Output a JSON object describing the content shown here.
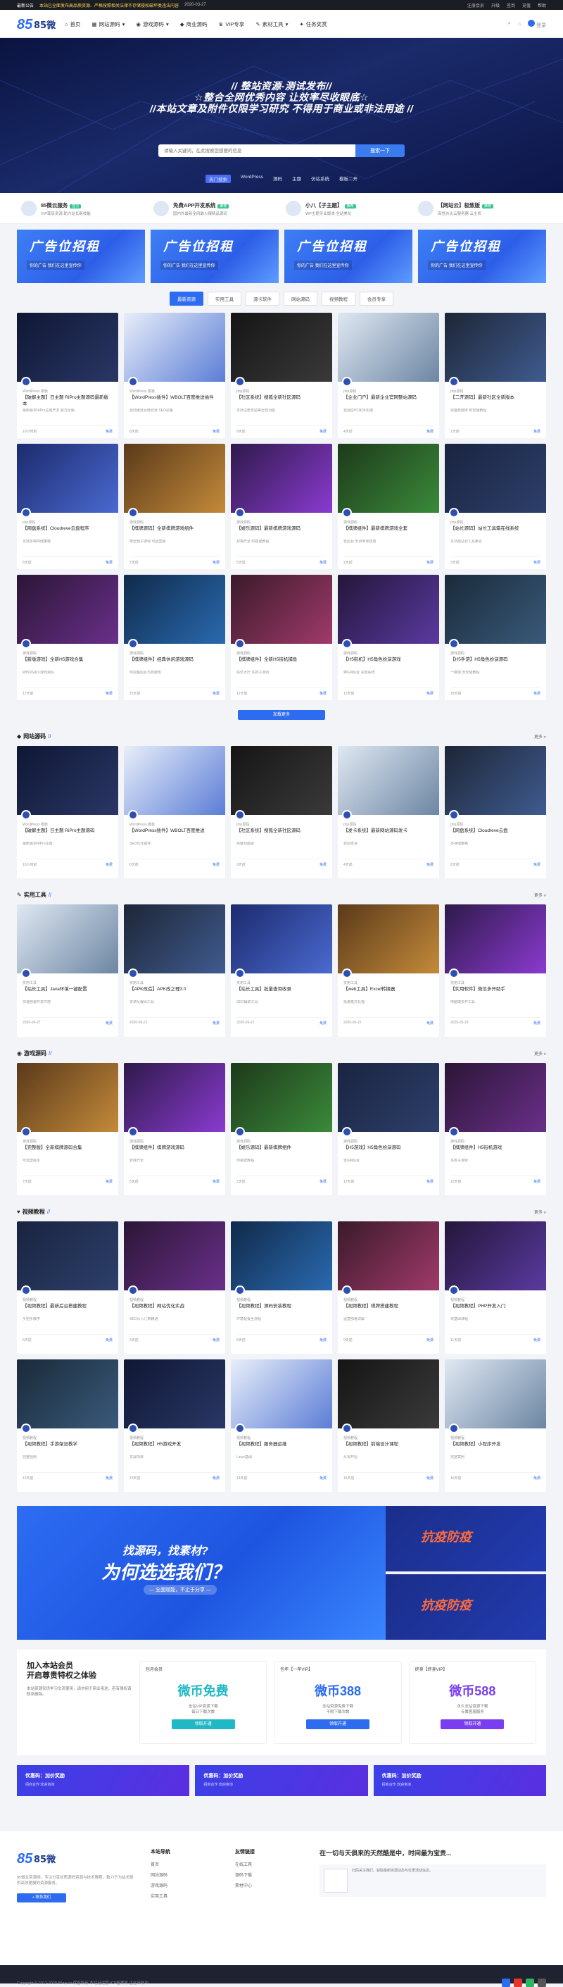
{
  "topbar": {
    "notice_label": "最新公告",
    "notice": "本站已全面发布高品质资源、严格按照相关法律不存储侵权破坏类违法内容",
    "date": "2020-03-27",
    "links": [
      "注册会员",
      "升级",
      "签到",
      "充值",
      "帮助"
    ]
  },
  "nav": {
    "logo": "85微云",
    "items": [
      "首页",
      "网站源码",
      "游戏源码",
      "商业源码",
      "VIP专享",
      "素材工具",
      "任务奖赏"
    ],
    "user": "登录"
  },
  "hero": {
    "line1": "// 整站资源-测试发布//",
    "line2": "☆整合全网优秀内容 让效率尽收眼底☆",
    "line3": "//本站文章及附件仅限学习研究 不得用于商业或非法用途 //",
    "search_placeholder": "请输入关键词，在此搜索您想要的信息",
    "search_btn": "搜索一下",
    "hotkeys": [
      "热门搜索",
      "WordPress",
      "源码",
      "主题",
      "仿站系统",
      "模板二开"
    ]
  },
  "promos": [
    {
      "title": "85微云服务",
      "tag": "官方",
      "desc": "VIP尊享资源 助力站长新技能"
    },
    {
      "title": "免费APP开发系统",
      "tag": "推荐",
      "desc": "国内外最新全网最火爆精品源码"
    },
    {
      "title": "小八【子主题】",
      "tag": "推荐",
      "desc": "WP主题专业版本 全站美化"
    },
    {
      "title": "【网站云】极致版",
      "tag": "推荐",
      "desc": "高性价比云服务器 云主机"
    }
  ],
  "ads": [
    {
      "t": "广告位招租",
      "s": "你的广告 我们在这里宣传你"
    },
    {
      "t": "广告位招租",
      "s": "你的广告 我们在这里宣传你"
    },
    {
      "t": "广告位招租",
      "s": "你的广告 我们在这里宣传你"
    },
    {
      "t": "广告位招租",
      "s": "你的广告 我们在这里宣传你"
    }
  ],
  "tabs": [
    "最新资源",
    "实用工具",
    "源卡软件",
    "网站源码",
    "视频教程",
    "会员专享"
  ],
  "latest": [
    {
      "meta": "WordPress 模板",
      "title": "【破解主题】日主题 RiPro主题源码最新版本",
      "ex": "最新版本RiPro主题开发 官方原版",
      "views": "10小时前",
      "tag": "免费"
    },
    {
      "meta": "WordPress 模板",
      "title": "【WordPress插件】WBOLT百度推送插件",
      "ex": "自动推送百度收录 SEO必备",
      "views": "6天前",
      "tag": "免费"
    },
    {
      "meta": "php源码",
      "title": "【社区系统】搜狐全新社区源码",
      "ex": "支持注册发帖等全部功能",
      "views": "9天前",
      "tag": "免费"
    },
    {
      "meta": "php源码",
      "title": "【企业门户】最新企业官网整站源码",
      "ex": "自适应PC和手机端",
      "views": "4天前",
      "tag": "免费"
    },
    {
      "meta": "php源码",
      "title": "【二开源码】最新社区全新版本",
      "ex": "完整数据库 附安装教程",
      "views": "1天前",
      "tag": "免费"
    },
    {
      "meta": "php源码",
      "title": "【网盘系统】Cloudreve云盘程序",
      "ex": "支持多种存储策略",
      "views": "8天前",
      "tag": "免费"
    },
    {
      "meta": "游戏源码",
      "title": "【棋牌源码】全新棋牌游戏组件",
      "ex": "带全部子游戏 可运营版",
      "views": "7天前",
      "tag": "免费"
    },
    {
      "meta": "游戏源码",
      "title": "【娱乐源码】最新棋牌游戏源码",
      "ex": "双端齐全 附搭建教程",
      "views": "5天前",
      "tag": "免费"
    },
    {
      "meta": "游戏源码",
      "title": "【棋牌组件】最新棋牌游戏全套",
      "ex": "含后台 安卓苹果双端",
      "views": "2天前",
      "tag": "免费"
    },
    {
      "meta": "php源码",
      "title": "【站长源码】站长工具箱在线系统",
      "ex": "多功能站长工具聚合",
      "views": "3天前",
      "tag": "免费"
    },
    {
      "meta": "游戏源码",
      "title": "【新版游戏】全新H5游戏合集",
      "ex": "即时对战小游戏源码",
      "views": "17天前",
      "tag": "免费"
    },
    {
      "meta": "游戏源码",
      "title": "【棋牌组件】经典休闲游戏源码",
      "ex": "附完整后台与数据库",
      "views": "15天前",
      "tag": "免费"
    },
    {
      "meta": "游戏源码",
      "title": "【棋牌组件】全新H5街机捕鱼",
      "ex": "高仿大厅 多款子游戏",
      "views": "12天前",
      "tag": "免费"
    },
    {
      "meta": "游戏源码",
      "title": "【H5街机】H5角色扮演游戏",
      "ex": "带GM后台 充值系统",
      "views": "13天前",
      "tag": "免费"
    },
    {
      "meta": "游戏源码",
      "title": "【H5手游】H5角色扮演源码",
      "ex": "一键端 含安装教程",
      "views": "18天前",
      "tag": "免费"
    }
  ],
  "more_btn": "加载更多",
  "sections": [
    {
      "title": "网站源码",
      "more": "更多 »",
      "cards": [
        {
          "meta": "WordPress 模板",
          "title": "【破解主题】日主题 RiPro主题源码",
          "ex": "最新版本RiPro主题",
          "views": "10小时前",
          "tag": "免费"
        },
        {
          "meta": "WordPress 模板",
          "title": "【WordPress插件】WBOLT百度推送",
          "ex": "SEO优化插件",
          "views": "6天前",
          "tag": "免费"
        },
        {
          "meta": "php源码",
          "title": "【社区系统】搜狐全新社区源码",
          "ex": "完整功能版",
          "views": "9天前",
          "tag": "免费"
        },
        {
          "meta": "php源码",
          "title": "【发卡系统】最新网站源码发卡",
          "ex": "自动发货",
          "views": "4天前",
          "tag": "免费"
        },
        {
          "meta": "php源码",
          "title": "【网盘系统】Cloudreve云盘",
          "ex": "多存储策略",
          "views": "8天前",
          "tag": "免费"
        }
      ]
    },
    {
      "title": "实用工具",
      "more": "更多 »",
      "cards": [
        {
          "meta": "实用工具",
          "title": "【站长工具】Java环境一键配置",
          "ex": "快速部署开发环境",
          "views": "2020-06-27",
          "tag": "免费"
        },
        {
          "meta": "实用工具",
          "title": "【APK改造】APK改之理3.0",
          "ex": "安卓反编译工具",
          "views": "2020-06-27",
          "tag": "免费"
        },
        {
          "meta": "实用工具",
          "title": "【站长工具】批量查询收录",
          "ex": "SEO辅助工具",
          "views": "2020-06-27",
          "tag": "免费"
        },
        {
          "meta": "实用工具",
          "title": "【web工具】Excel转换器",
          "ex": "批量格式处理",
          "views": "2020-06-22",
          "tag": "免费"
        },
        {
          "meta": "实用工具",
          "title": "【实用软件】微信多开助手",
          "ex": "电脑端多开工具",
          "views": "2020-05-29",
          "tag": "免费"
        }
      ]
    },
    {
      "title": "游戏源码",
      "more": "更多 »",
      "cards": [
        {
          "meta": "游戏源码",
          "title": "【完整版】全新棋牌源码合集",
          "ex": "可运营版本",
          "views": "7天前",
          "tag": "免费"
        },
        {
          "meta": "游戏源码",
          "title": "【棋牌组件】棋牌游戏源码",
          "ex": "双端齐全",
          "views": "5天前",
          "tag": "免费"
        },
        {
          "meta": "游戏源码",
          "title": "【娱乐源码】最新棋牌组件",
          "ex": "附搭建教程",
          "views": "2天前",
          "tag": "免费"
        },
        {
          "meta": "游戏源码",
          "title": "【H5游戏】H5角色扮演源码",
          "ex": "含GM后台",
          "views": "12天前",
          "tag": "免费"
        },
        {
          "meta": "游戏源码",
          "title": "【棋牌组件】H5街机游戏",
          "ex": "多款子游戏",
          "views": "13天前",
          "tag": "免费"
        }
      ]
    },
    {
      "title": "视频教程",
      "more": "更多 »",
      "cards": [
        {
          "meta": "视频教程",
          "title": "【视频教程】最新后台搭建教程",
          "ex": "手把手教学",
          "views": "5天前",
          "tag": "免费"
        },
        {
          "meta": "视频教程",
          "title": "【视频教程】网站优化实战",
          "ex": "SEO从入门到精通",
          "views": "6天前",
          "tag": "免费"
        },
        {
          "meta": "视频教程",
          "title": "【视频教程】源码安装教程",
          "ex": "环境配置全流程",
          "views": "8天前",
          "tag": "免费"
        },
        {
          "meta": "视频教程",
          "title": "【视频教程】棋牌搭建教程",
          "ex": "运营部署详解",
          "views": "9天前",
          "tag": "免费"
        },
        {
          "meta": "视频教程",
          "title": "【视频教程】PHP开发入门",
          "ex": "零基础课程",
          "views": "11天前",
          "tag": "免费"
        },
        {
          "meta": "视频教程",
          "title": "【视频教程】手游架设教学",
          "ex": "完整视频",
          "views": "12天前",
          "tag": "免费"
        },
        {
          "meta": "视频教程",
          "title": "【视频教程】H5游戏开发",
          "ex": "实战项目",
          "views": "13天前",
          "tag": "免费"
        },
        {
          "meta": "视频教程",
          "title": "【视频教程】服务器运维",
          "ex": "Linux基础",
          "views": "14天前",
          "tag": "免费"
        },
        {
          "meta": "视频教程",
          "title": "【视频教程】前端设计课程",
          "ex": "从零开始",
          "views": "15天前",
          "tag": "免费"
        },
        {
          "meta": "视频教程",
          "title": "【视频教程】小程序开发",
          "ex": "完整案例",
          "views": "16天前",
          "tag": "免费"
        }
      ]
    }
  ],
  "banner": {
    "l1": "找源码，找素材?",
    "l2": "为何选选我们？",
    "l3": "— 全面赋能，不止于分享 —",
    "r1": "抗疫防疫",
    "r2": "抗疫防疫"
  },
  "vip": {
    "title": "加入本站会员\n开启尊贵特权之体验",
    "desc": "本站资源仅供学习交流使用，请勿用于商业用途，若有侵权请联系删除。",
    "plans": [
      {
        "name": "包月会员",
        "price": "微币免费",
        "li": "全站VIP资源下载\n每日下载次数",
        "btn": "领取开通",
        "color": "#1fb8c4"
      },
      {
        "name": "包年【一年VIP】",
        "price": "微币388",
        "li": "全站资源免费下载\n不限下载次数",
        "btn": "领取开通",
        "color": "#2d6bf0"
      },
      {
        "name": "终身【终身VIP】",
        "price": "微币588",
        "li": "永久全站资源下载\n专属客服服务",
        "btn": "领取开通",
        "color": "#7a3ef0"
      }
    ]
  },
  "ads2": [
    {
      "t": "优惠码：加价奖励",
      "s": "招商合作 欢迎咨询"
    },
    {
      "t": "优惠码：加价奖励",
      "s": "招商合作 欢迎咨询"
    },
    {
      "t": "优惠码：加价奖励",
      "s": "招商合作 欢迎咨询"
    }
  ],
  "footer": {
    "logo": "85微云",
    "about": "85微云资源网，专注分享优质源码资源与技术教程，致力于为站长提供高效便捷的资源服务。",
    "contact": "+ 联系我们",
    "col2_title": "本站导航",
    "col2": [
      "首页",
      "网站源码",
      "游戏源码",
      "实用工具"
    ],
    "col3_title": "友情链接",
    "col3": [
      "在线工具",
      "源码下载",
      "素材中心"
    ],
    "col4_title": "在一切与天俱来的天然酷是中，时间最为宝贵...",
    "qr_text": "扫码关注我们，获取最新资源动态与优惠活动信息。",
    "copyright": "Copyright © 2012-2020 85wy.cn 保留所有 本站已运营 ICP备案号 正在审核中"
  }
}
